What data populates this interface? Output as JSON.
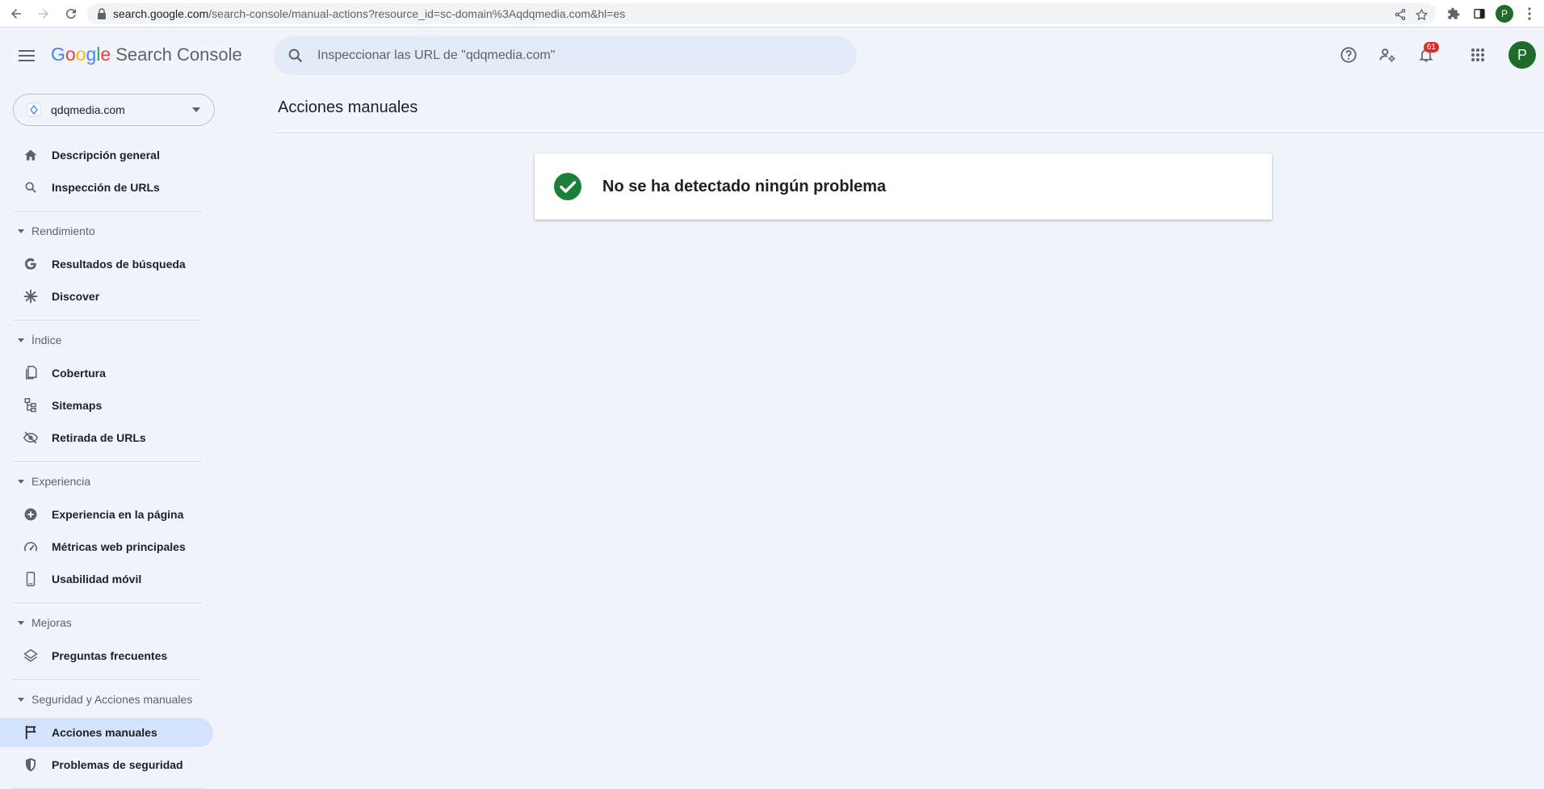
{
  "browser": {
    "url_host": "search.google.com",
    "url_path": "/search-console/manual-actions?resource_id=sc-domain%3Aqdqmedia.com&hl=es",
    "profile_initial": "P"
  },
  "header": {
    "logo_google": "Google",
    "logo_product": "Search Console",
    "search_placeholder": "Inspeccionar las URL de \"qdqmedia.com\"",
    "notification_count": "61",
    "avatar_initial": "P"
  },
  "sidebar": {
    "property": "qdqmedia.com",
    "top_items": [
      {
        "label": "Descripción general",
        "icon": "home-icon"
      },
      {
        "label": "Inspección de URLs",
        "icon": "search-icon"
      }
    ],
    "sections": [
      {
        "title": "Rendimiento",
        "items": [
          {
            "label": "Resultados de búsqueda",
            "icon": "google-g-icon"
          },
          {
            "label": "Discover",
            "icon": "asterisk-icon"
          }
        ]
      },
      {
        "title": "Índice",
        "items": [
          {
            "label": "Cobertura",
            "icon": "pages-icon"
          },
          {
            "label": "Sitemaps",
            "icon": "sitemap-icon"
          },
          {
            "label": "Retirada de URLs",
            "icon": "eye-off-icon"
          }
        ]
      },
      {
        "title": "Experiencia",
        "items": [
          {
            "label": "Experiencia en la página",
            "icon": "plus-circle-icon"
          },
          {
            "label": "Métricas web principales",
            "icon": "gauge-icon"
          },
          {
            "label": "Usabilidad móvil",
            "icon": "phone-icon"
          }
        ]
      },
      {
        "title": "Mejoras",
        "items": [
          {
            "label": "Preguntas frecuentes",
            "icon": "layers-icon"
          }
        ]
      },
      {
        "title": "Seguridad y Acciones manuales",
        "items": [
          {
            "label": "Acciones manuales",
            "icon": "flag-icon",
            "active": true
          },
          {
            "label": "Problemas de seguridad",
            "icon": "shield-icon"
          }
        ]
      }
    ]
  },
  "main": {
    "title": "Acciones manuales",
    "status_message": "No se ha detectado ningún problema",
    "status_color": "#188038"
  }
}
